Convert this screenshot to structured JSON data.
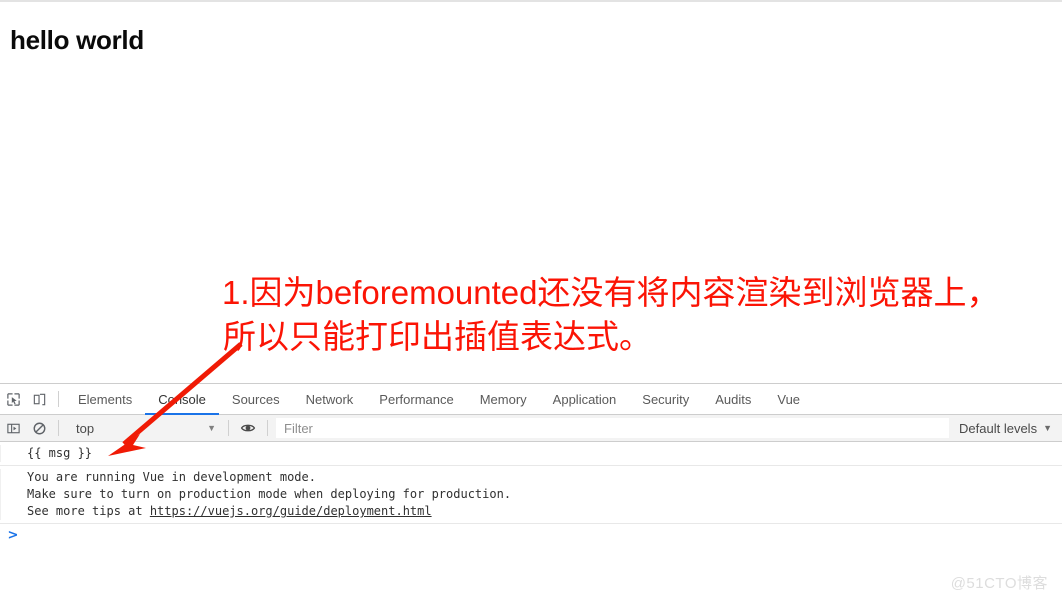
{
  "page": {
    "heading": "hello world"
  },
  "annotation": {
    "line1": "1.因为beforemounted还没有将内容渲染到浏览器上，",
    "line2": "所以只能打印出插值表达式。",
    "color": "#fb1405",
    "arrow_from": "240,345",
    "arrow_to": "110,455"
  },
  "devtools": {
    "icons": {
      "inspect": "inspect-element-icon",
      "device": "device-toolbar-icon",
      "sidebar": "console-sidebar-icon",
      "clear": "clear-console-icon",
      "eye": "live-expression-eye-icon"
    },
    "tabs": [
      {
        "label": "Elements",
        "active": false
      },
      {
        "label": "Console",
        "active": true
      },
      {
        "label": "Sources",
        "active": false
      },
      {
        "label": "Network",
        "active": false
      },
      {
        "label": "Performance",
        "active": false
      },
      {
        "label": "Memory",
        "active": false
      },
      {
        "label": "Application",
        "active": false
      },
      {
        "label": "Security",
        "active": false
      },
      {
        "label": "Audits",
        "active": false
      },
      {
        "label": "Vue",
        "active": false
      }
    ],
    "active_tab_accent": "#1a73e8",
    "filterbar": {
      "context": "top",
      "context_caret": "▼",
      "filter_value": "",
      "filter_placeholder": "Filter",
      "levels": "Default levels",
      "levels_caret": "▼"
    },
    "console": {
      "prompt_symbol": ">",
      "messages": [
        {
          "type": "log",
          "lines": [
            "{{ msg }}"
          ]
        },
        {
          "type": "info",
          "lines": [
            "You are running Vue in development mode.",
            "Make sure to turn on production mode when deploying for production.",
            "See more tips at "
          ],
          "link": "https://vuejs.org/guide/deployment.html"
        }
      ]
    }
  },
  "watermark": {
    "text": "@51CTO博客"
  }
}
